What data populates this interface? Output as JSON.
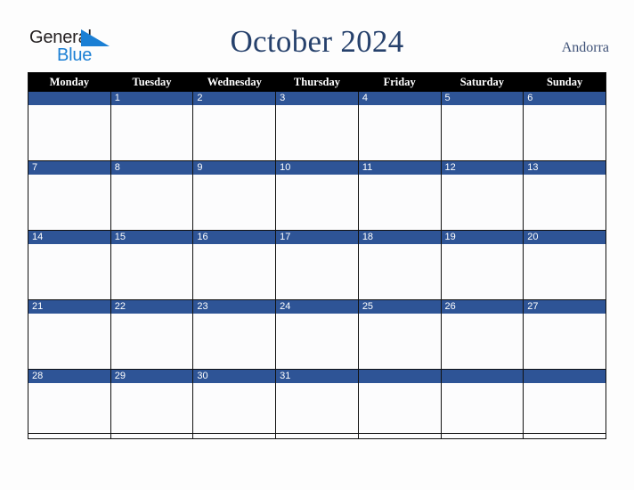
{
  "brand": {
    "name_part1": "General",
    "name_part2": "Blue",
    "triangle_color": "#1b7fd4",
    "text_color": "#231f20"
  },
  "header": {
    "title": "October 2024",
    "country": "Andorra",
    "title_color": "#26416c",
    "country_color": "#3f5278"
  },
  "calendar": {
    "accent_color": "#2e5496",
    "header_bg": "#000000",
    "cell_bg": "#fcfcfd",
    "weekday_headers": [
      "Monday",
      "Tuesday",
      "Wednesday",
      "Thursday",
      "Friday",
      "Saturday",
      "Sunday"
    ],
    "weeks": [
      [
        "",
        "1",
        "2",
        "3",
        "4",
        "5",
        "6"
      ],
      [
        "7",
        "8",
        "9",
        "10",
        "11",
        "12",
        "13"
      ],
      [
        "14",
        "15",
        "16",
        "17",
        "18",
        "19",
        "20"
      ],
      [
        "21",
        "22",
        "23",
        "24",
        "25",
        "26",
        "27"
      ],
      [
        "28",
        "29",
        "30",
        "31",
        "",
        "",
        ""
      ]
    ]
  }
}
